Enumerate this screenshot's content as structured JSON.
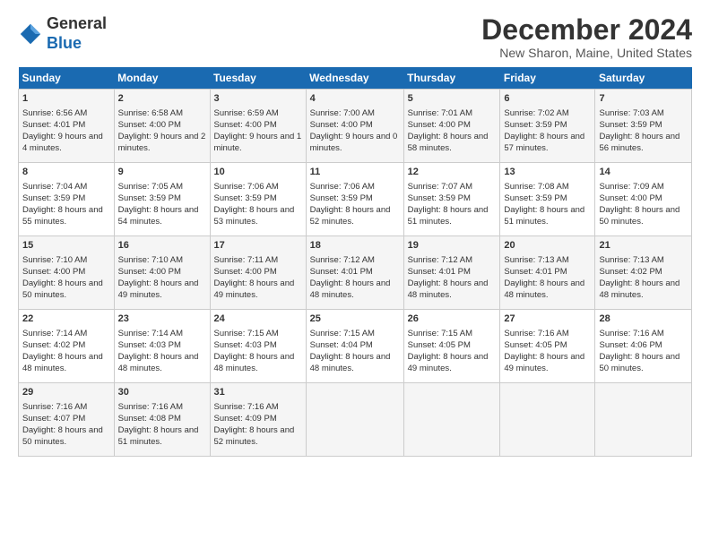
{
  "logo": {
    "general": "General",
    "blue": "Blue"
  },
  "title": "December 2024",
  "location": "New Sharon, Maine, United States",
  "headers": [
    "Sunday",
    "Monday",
    "Tuesday",
    "Wednesday",
    "Thursday",
    "Friday",
    "Saturday"
  ],
  "weeks": [
    [
      {
        "day": "1",
        "sunrise": "Sunrise: 6:56 AM",
        "sunset": "Sunset: 4:01 PM",
        "daylight": "Daylight: 9 hours and 4 minutes."
      },
      {
        "day": "2",
        "sunrise": "Sunrise: 6:58 AM",
        "sunset": "Sunset: 4:00 PM",
        "daylight": "Daylight: 9 hours and 2 minutes."
      },
      {
        "day": "3",
        "sunrise": "Sunrise: 6:59 AM",
        "sunset": "Sunset: 4:00 PM",
        "daylight": "Daylight: 9 hours and 1 minute."
      },
      {
        "day": "4",
        "sunrise": "Sunrise: 7:00 AM",
        "sunset": "Sunset: 4:00 PM",
        "daylight": "Daylight: 9 hours and 0 minutes."
      },
      {
        "day": "5",
        "sunrise": "Sunrise: 7:01 AM",
        "sunset": "Sunset: 4:00 PM",
        "daylight": "Daylight: 8 hours and 58 minutes."
      },
      {
        "day": "6",
        "sunrise": "Sunrise: 7:02 AM",
        "sunset": "Sunset: 3:59 PM",
        "daylight": "Daylight: 8 hours and 57 minutes."
      },
      {
        "day": "7",
        "sunrise": "Sunrise: 7:03 AM",
        "sunset": "Sunset: 3:59 PM",
        "daylight": "Daylight: 8 hours and 56 minutes."
      }
    ],
    [
      {
        "day": "8",
        "sunrise": "Sunrise: 7:04 AM",
        "sunset": "Sunset: 3:59 PM",
        "daylight": "Daylight: 8 hours and 55 minutes."
      },
      {
        "day": "9",
        "sunrise": "Sunrise: 7:05 AM",
        "sunset": "Sunset: 3:59 PM",
        "daylight": "Daylight: 8 hours and 54 minutes."
      },
      {
        "day": "10",
        "sunrise": "Sunrise: 7:06 AM",
        "sunset": "Sunset: 3:59 PM",
        "daylight": "Daylight: 8 hours and 53 minutes."
      },
      {
        "day": "11",
        "sunrise": "Sunrise: 7:06 AM",
        "sunset": "Sunset: 3:59 PM",
        "daylight": "Daylight: 8 hours and 52 minutes."
      },
      {
        "day": "12",
        "sunrise": "Sunrise: 7:07 AM",
        "sunset": "Sunset: 3:59 PM",
        "daylight": "Daylight: 8 hours and 51 minutes."
      },
      {
        "day": "13",
        "sunrise": "Sunrise: 7:08 AM",
        "sunset": "Sunset: 3:59 PM",
        "daylight": "Daylight: 8 hours and 51 minutes."
      },
      {
        "day": "14",
        "sunrise": "Sunrise: 7:09 AM",
        "sunset": "Sunset: 4:00 PM",
        "daylight": "Daylight: 8 hours and 50 minutes."
      }
    ],
    [
      {
        "day": "15",
        "sunrise": "Sunrise: 7:10 AM",
        "sunset": "Sunset: 4:00 PM",
        "daylight": "Daylight: 8 hours and 50 minutes."
      },
      {
        "day": "16",
        "sunrise": "Sunrise: 7:10 AM",
        "sunset": "Sunset: 4:00 PM",
        "daylight": "Daylight: 8 hours and 49 minutes."
      },
      {
        "day": "17",
        "sunrise": "Sunrise: 7:11 AM",
        "sunset": "Sunset: 4:00 PM",
        "daylight": "Daylight: 8 hours and 49 minutes."
      },
      {
        "day": "18",
        "sunrise": "Sunrise: 7:12 AM",
        "sunset": "Sunset: 4:01 PM",
        "daylight": "Daylight: 8 hours and 48 minutes."
      },
      {
        "day": "19",
        "sunrise": "Sunrise: 7:12 AM",
        "sunset": "Sunset: 4:01 PM",
        "daylight": "Daylight: 8 hours and 48 minutes."
      },
      {
        "day": "20",
        "sunrise": "Sunrise: 7:13 AM",
        "sunset": "Sunset: 4:01 PM",
        "daylight": "Daylight: 8 hours and 48 minutes."
      },
      {
        "day": "21",
        "sunrise": "Sunrise: 7:13 AM",
        "sunset": "Sunset: 4:02 PM",
        "daylight": "Daylight: 8 hours and 48 minutes."
      }
    ],
    [
      {
        "day": "22",
        "sunrise": "Sunrise: 7:14 AM",
        "sunset": "Sunset: 4:02 PM",
        "daylight": "Daylight: 8 hours and 48 minutes."
      },
      {
        "day": "23",
        "sunrise": "Sunrise: 7:14 AM",
        "sunset": "Sunset: 4:03 PM",
        "daylight": "Daylight: 8 hours and 48 minutes."
      },
      {
        "day": "24",
        "sunrise": "Sunrise: 7:15 AM",
        "sunset": "Sunset: 4:03 PM",
        "daylight": "Daylight: 8 hours and 48 minutes."
      },
      {
        "day": "25",
        "sunrise": "Sunrise: 7:15 AM",
        "sunset": "Sunset: 4:04 PM",
        "daylight": "Daylight: 8 hours and 48 minutes."
      },
      {
        "day": "26",
        "sunrise": "Sunrise: 7:15 AM",
        "sunset": "Sunset: 4:05 PM",
        "daylight": "Daylight: 8 hours and 49 minutes."
      },
      {
        "day": "27",
        "sunrise": "Sunrise: 7:16 AM",
        "sunset": "Sunset: 4:05 PM",
        "daylight": "Daylight: 8 hours and 49 minutes."
      },
      {
        "day": "28",
        "sunrise": "Sunrise: 7:16 AM",
        "sunset": "Sunset: 4:06 PM",
        "daylight": "Daylight: 8 hours and 50 minutes."
      }
    ],
    [
      {
        "day": "29",
        "sunrise": "Sunrise: 7:16 AM",
        "sunset": "Sunset: 4:07 PM",
        "daylight": "Daylight: 8 hours and 50 minutes."
      },
      {
        "day": "30",
        "sunrise": "Sunrise: 7:16 AM",
        "sunset": "Sunset: 4:08 PM",
        "daylight": "Daylight: 8 hours and 51 minutes."
      },
      {
        "day": "31",
        "sunrise": "Sunrise: 7:16 AM",
        "sunset": "Sunset: 4:09 PM",
        "daylight": "Daylight: 8 hours and 52 minutes."
      },
      null,
      null,
      null,
      null
    ]
  ]
}
